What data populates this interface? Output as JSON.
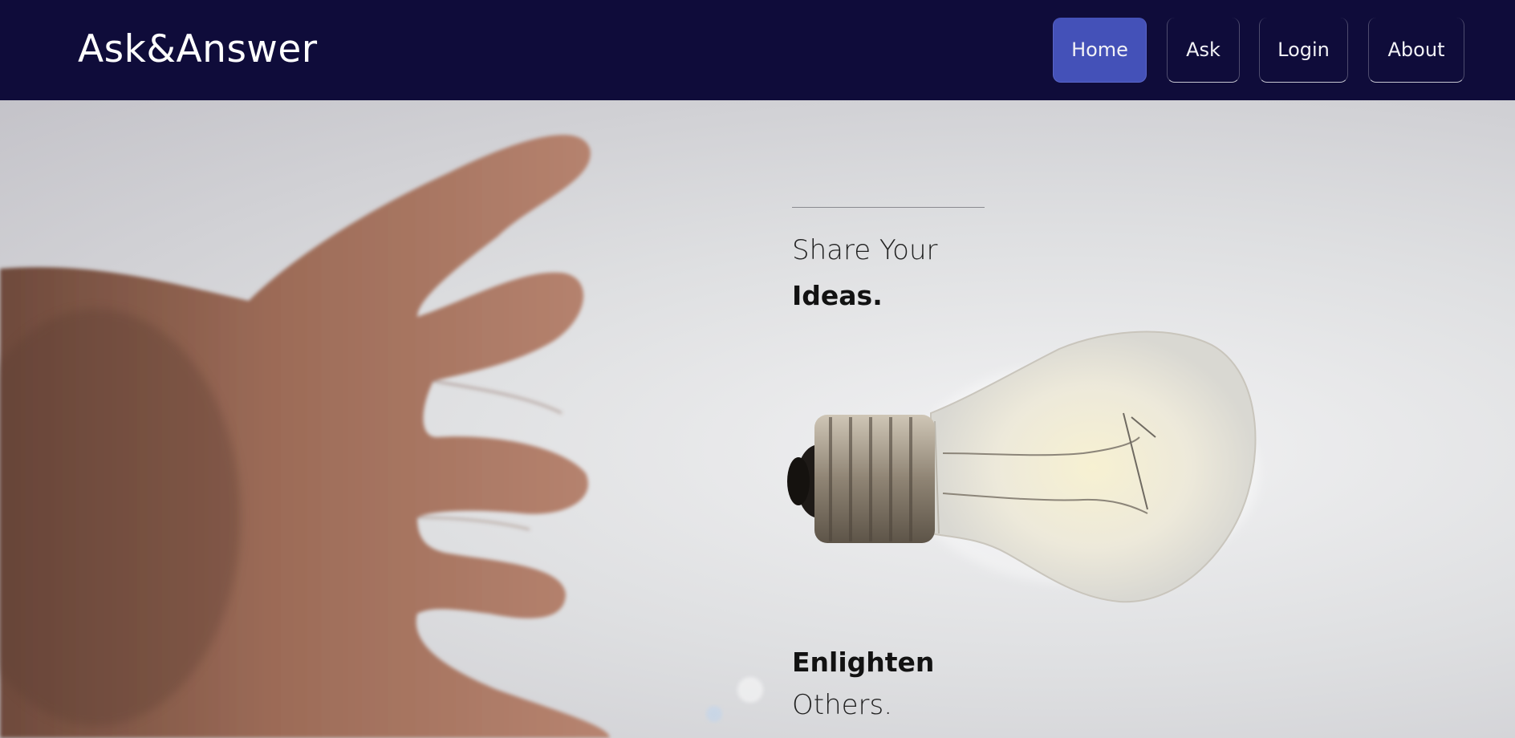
{
  "brand": {
    "name": "Ask&Answer"
  },
  "nav": {
    "items": [
      {
        "label": "Home",
        "active": true
      },
      {
        "label": "Ask",
        "active": false
      },
      {
        "label": "Login",
        "active": false
      },
      {
        "label": "About",
        "active": false
      }
    ]
  },
  "hero": {
    "line1": "Share Your",
    "line2": "Ideas.",
    "line3": "Enlighten",
    "line4": "Others.",
    "image_subject": "hand reaching for a light bulb"
  },
  "colors": {
    "navbar": "#0f0c3a",
    "active_nav": "#4451b8",
    "nav_text": "#f2f2f6",
    "hero_text": "#121212"
  }
}
